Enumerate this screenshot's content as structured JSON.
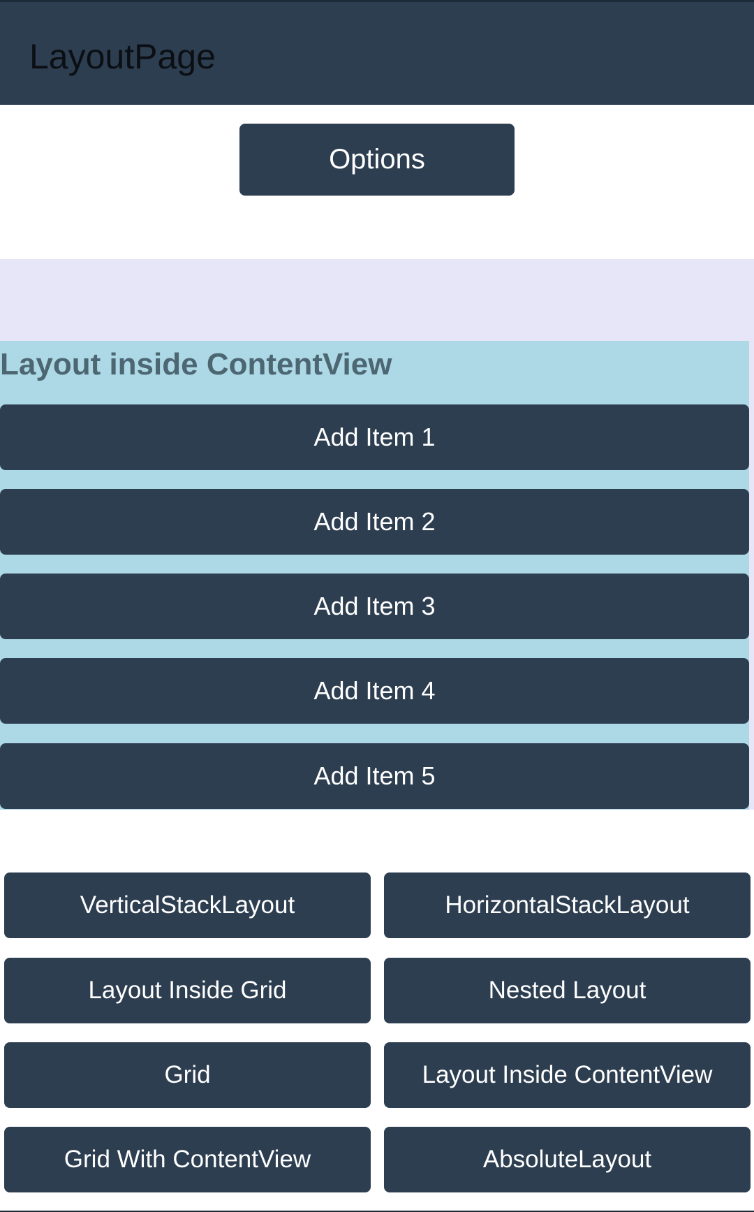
{
  "app_bar": {
    "title": "LayoutPage"
  },
  "options_label": "Options",
  "content_view": {
    "heading": "Layout inside ContentView",
    "items": [
      "Add Item 1",
      "Add Item 2",
      "Add Item 3",
      "Add Item 4",
      "Add Item 5"
    ]
  },
  "nav_buttons": [
    "VerticalStackLayout",
    "HorizontalStackLayout",
    "Layout Inside Grid",
    "Nested Layout",
    "Grid",
    "Layout Inside ContentView",
    "Grid With ContentView",
    "AbsoluteLayout"
  ],
  "colors": {
    "primary": "#2d3e50",
    "content_view_bg": "#add8e6",
    "lavender_bg": "#e6e6f8",
    "heading_text": "#4c6672"
  }
}
